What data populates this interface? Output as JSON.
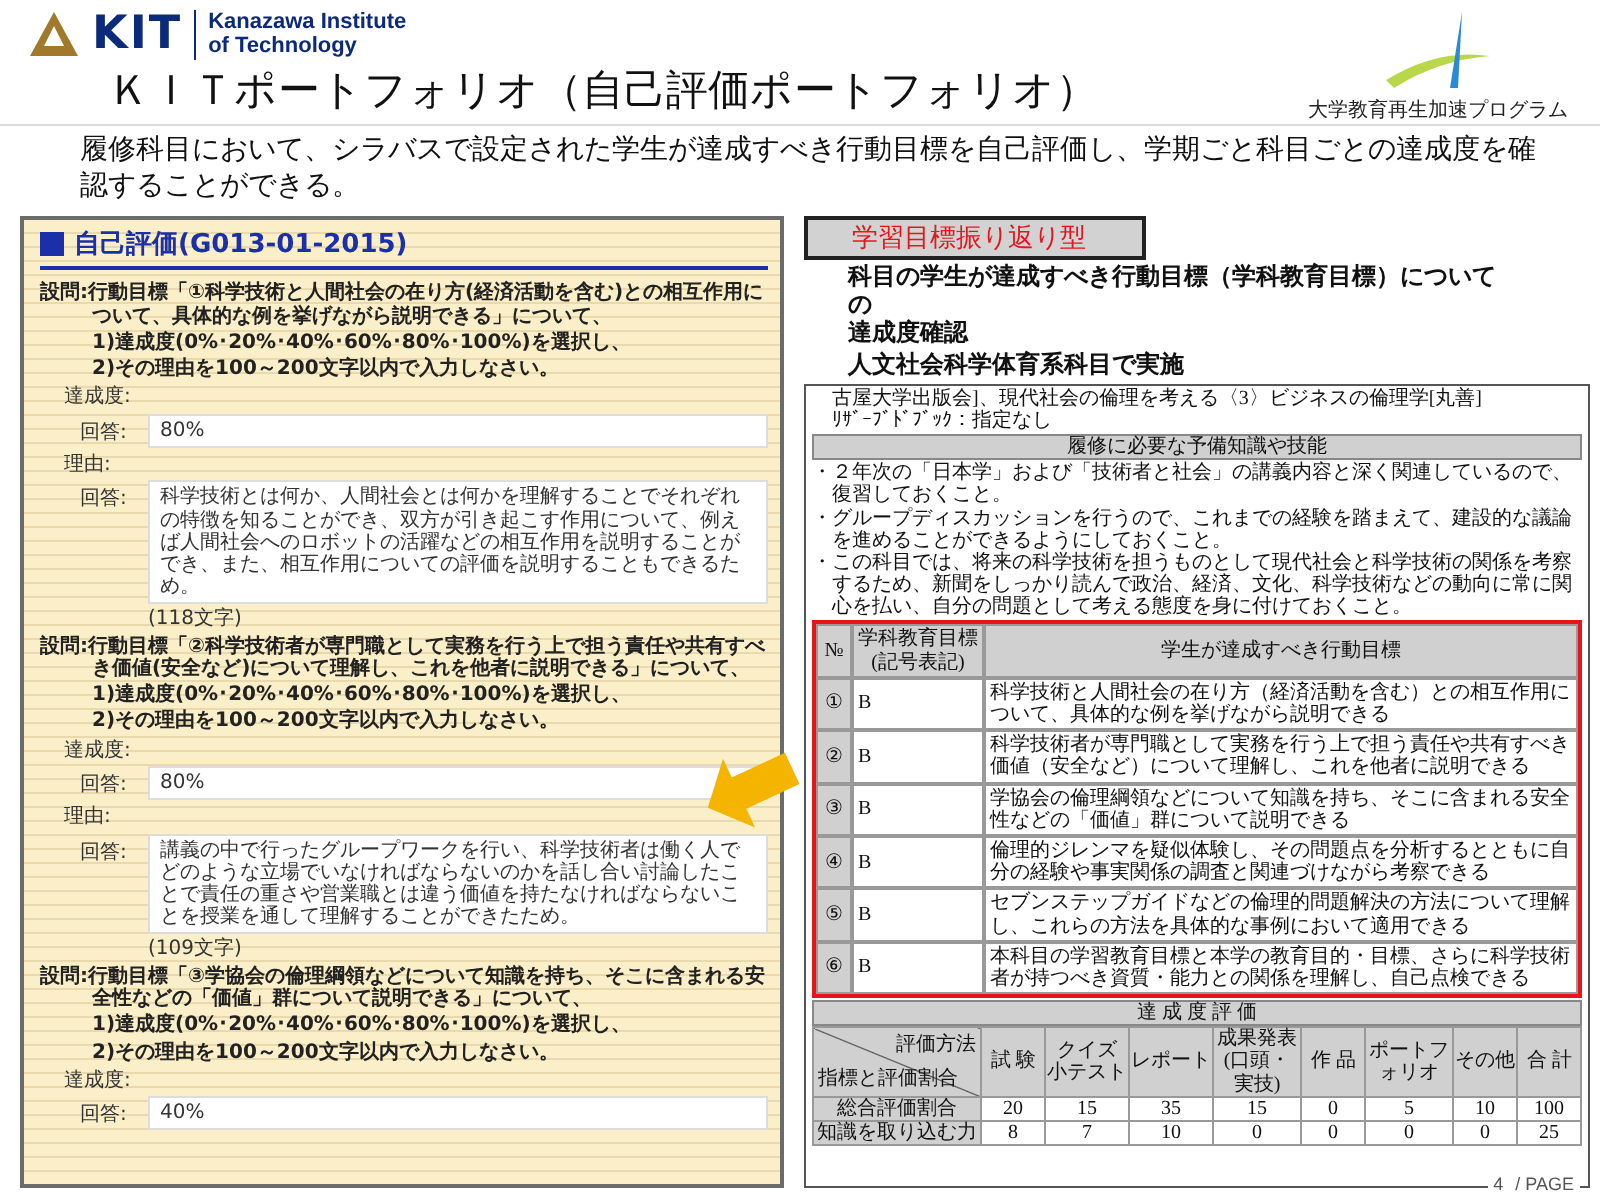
{
  "header": {
    "logo": {
      "mark": "KIT",
      "name_lines": [
        "Kanazawa Institute",
        "of Technology"
      ]
    },
    "program_logo_text": "大学教育再生加速プログラム",
    "title": "ＫＩＴポートフォリオ（自己評価ポートフォリオ）",
    "description": "履修科目において、シラバスで設定された学生が達成すべき行動目標を自己評価し、学期ごと科目ごとの達成度を確認することができる。"
  },
  "self_evaluation": {
    "title": "自己評価(G013-01-2015)",
    "questions": [
      {
        "prompt": "設問:行動目標「①科学技術と人間社会の在り方(経済活動を含む)との相互作用について、具体的な例を挙げながら説明できる」について、",
        "instructions": [
          "1)達成度(0%･20%･40%･60%･80%･100%)を選択し、",
          "2)その理由を100～200文字以内で入力しなさい。"
        ],
        "fields": [
          {
            "label": "達成度:",
            "answer_label": "回答:",
            "value": "80%"
          },
          {
            "label": "理由:",
            "answer_label": "回答:",
            "value": "科学技術とは何か、人間社会とは何かを理解することでそれぞれの特徴を知ることができ、双方が引き起こす作用について、例えば人間社会へのロボットの活躍などの相互作用を説明することができ、また、相互作用についての評価を説明することもできるため。",
            "char_count": "(118文字)"
          }
        ]
      },
      {
        "prompt": "設問:行動目標「②科学技術者が専門職として実務を行う上で担う責任や共有すべき価値(安全など)について理解し、これを他者に説明できる」について、",
        "instructions": [
          "1)達成度(0%･20%･40%･60%･80%･100%)を選択し、",
          "2)その理由を100～200文字以内で入力しなさい。"
        ],
        "fields": [
          {
            "label": "達成度:",
            "answer_label": "回答:",
            "value": "80%"
          },
          {
            "label": "理由:",
            "answer_label": "回答:",
            "value": "講義の中で行ったグループワークを行い、科学技術者は働く人でどのような立場でいなければならないのかを話し合い討論したことで責任の重さや営業職とは違う価値を持たなければならないことを授業を通して理解することができたため。",
            "char_count": "(109文字)"
          }
        ]
      },
      {
        "prompt": "設問:行動目標「③学協会の倫理綱領などについて知識を持ち、そこに含まれる安全性などの「価値」群について説明できる」について、",
        "instructions": [
          "1)達成度(0%･20%･40%･60%･80%･100%)を選択し、",
          "2)その理由を100～200文字以内で入力しなさい。"
        ],
        "fields": [
          {
            "label": "達成度:",
            "answer_label": "回答:",
            "value": "40%"
          }
        ]
      }
    ]
  },
  "summary": {
    "tag": "学習目標振り返り型",
    "lines": [
      "科目の学生が達成すべき行動目標（学科教育目標）について",
      "の",
      "達成度確認"
    ],
    "note": "人文社会科学体育系科目で実施"
  },
  "syllabus": {
    "reference_lines": [
      "古屋大学出版会]、現代社会の倫理を考える〈3〉ビジネスの倫理学[丸善]",
      "ﾘｻﾞｰﾌﾞﾄﾞﾌﾞｯｸ：指定なし"
    ],
    "section_heading": "履修に必要な予備知識や技能",
    "bullets": [
      "・２年次の「日本学」および「技術者と社会」の講義内容と深く関連しているので、復習しておくこと。",
      "・グループディスカッションを行うので、これまでの経験を踏まえて、建設的な議論を進めることができるようにしておくこと。",
      "・この科目では、将来の科学技術を担うものとして現代社会と科学技術の関係を考察するため、新聞をしっかり読んで政治、経済、文化、科学技術などの動向に常に関心を払い、自分の問題として考える態度を身に付けておくこと。"
    ],
    "objectives": {
      "highlighted": true,
      "columns": [
        {
          "lines": [
            "№"
          ]
        },
        {
          "lines": [
            "学科教育目標",
            "(記号表記)"
          ]
        },
        {
          "lines": [
            "学生が達成すべき行動目標"
          ]
        }
      ],
      "rows": [
        {
          "no": "①",
          "code": "B",
          "goal": "科学技術と人間社会の在り方（経済活動を含む）との相互作用について、具体的な例を挙げながら説明できる"
        },
        {
          "no": "②",
          "code": "B",
          "goal": "科学技術者が専門職として実務を行う上で担う責任や共有すべき価値（安全など）について理解し、これを他者に説明できる"
        },
        {
          "no": "③",
          "code": "B",
          "goal": "学協会の倫理綱領などについて知識を持ち、そこに含まれる安全性などの「価値」群について説明できる"
        },
        {
          "no": "④",
          "code": "B",
          "goal": "倫理的ジレンマを疑似体験し、その問題点を分析するとともに自分の経験や事実関係の調査と関連づけながら考察できる"
        },
        {
          "no": "⑤",
          "code": "B",
          "goal": "セブンステップガイドなどの倫理的問題解決の方法について理解し、これらの方法を具体的な事例において適用できる"
        },
        {
          "no": "⑥",
          "code": "B",
          "goal": "本科目の学習教育目標と本学の教育目的・目標、さらに科学技術者が持つべき資質・能力との関係を理解し、自己点検できる"
        }
      ]
    },
    "evaluation": {
      "title": "達 成 度 評 価",
      "corner_top": "評価方法",
      "corner_bottom": "指標と評価割合",
      "columns": [
        {
          "lines": [
            "試 験"
          ]
        },
        {
          "lines": [
            "クイズ",
            "小テスト"
          ]
        },
        {
          "lines": [
            "レポート"
          ]
        },
        {
          "lines": [
            "成果発表",
            "(口頭・実技)"
          ]
        },
        {
          "lines": [
            "作 品"
          ]
        },
        {
          "lines": [
            "ポートフォリオ"
          ]
        },
        {
          "lines": [
            "その他"
          ]
        },
        {
          "lines": [
            "合 計"
          ]
        }
      ],
      "rows": [
        {
          "label": "総合評価割合",
          "values": [
            "20",
            "15",
            "35",
            "15",
            "0",
            "5",
            "10",
            "100"
          ]
        },
        {
          "label": "知識を取り込む力",
          "values": [
            "8",
            "7",
            "10",
            "0",
            "0",
            "0",
            "0",
            "25"
          ]
        }
      ]
    }
  },
  "footer": {
    "page_number": "4",
    "page_label": "/ PAGE"
  }
}
